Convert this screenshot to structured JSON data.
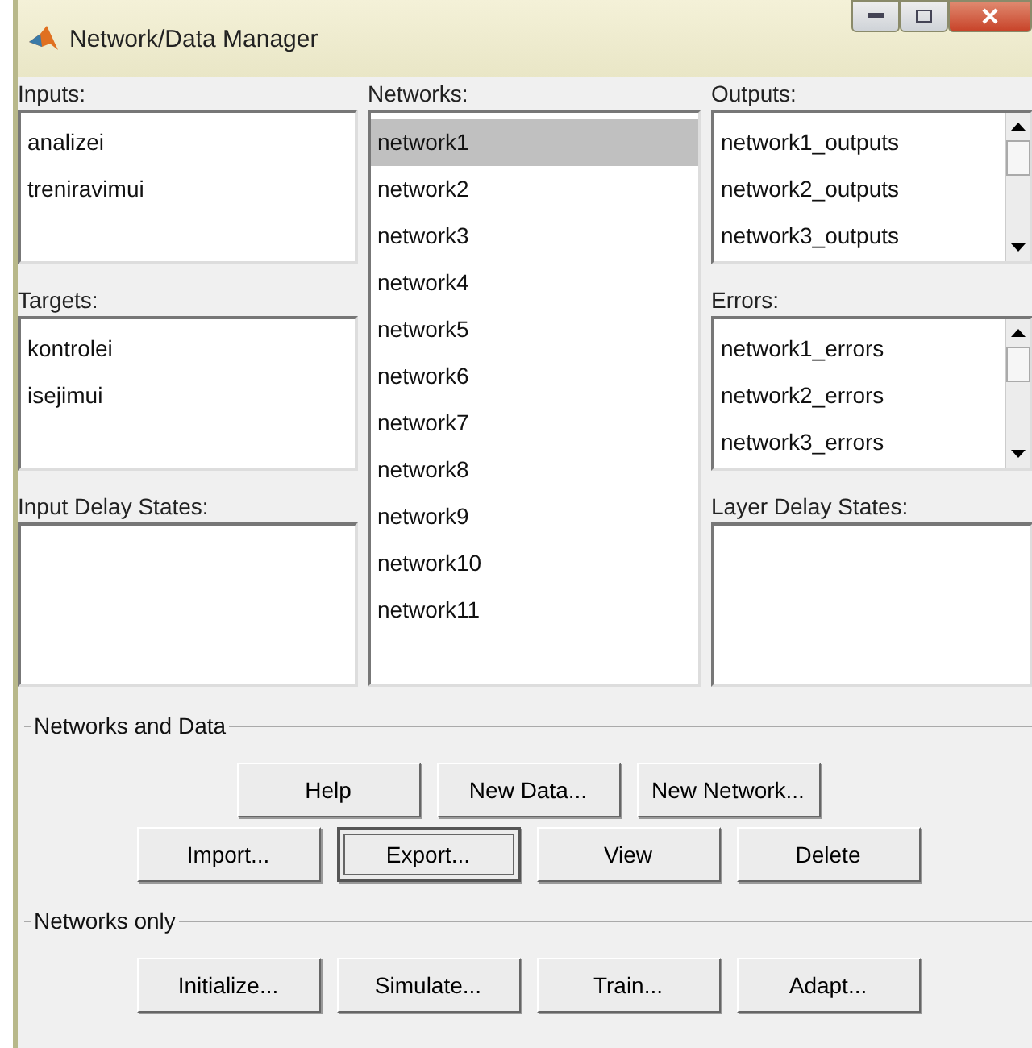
{
  "window": {
    "title": "Network/Data Manager"
  },
  "inputs": {
    "label": "Inputs:",
    "items": [
      "analizei",
      "treniravimui"
    ]
  },
  "targets": {
    "label": "Targets:",
    "items": [
      "kontrolei",
      "isejimui"
    ]
  },
  "input_delay_states": {
    "label": "Input Delay States:"
  },
  "networks": {
    "label": "Networks:",
    "items": [
      {
        "label": "network1",
        "selected": true
      },
      {
        "label": "network2",
        "selected": false
      },
      {
        "label": "network3",
        "selected": false
      },
      {
        "label": "network4",
        "selected": false
      },
      {
        "label": "network5",
        "selected": false
      },
      {
        "label": "network6",
        "selected": false
      },
      {
        "label": "network7",
        "selected": false
      },
      {
        "label": "network8",
        "selected": false
      },
      {
        "label": "network9",
        "selected": false
      },
      {
        "label": "network10",
        "selected": false
      },
      {
        "label": "network11",
        "selected": false
      }
    ]
  },
  "outputs": {
    "label": "Outputs:",
    "items": [
      "network1_outputs",
      "network2_outputs",
      "network3_outputs"
    ]
  },
  "errors": {
    "label": "Errors:",
    "items": [
      "network1_errors",
      "network2_errors",
      "network3_errors"
    ]
  },
  "layer_delay_states": {
    "label": "Layer Delay States:"
  },
  "groups": [
    {
      "title": "Networks and Data",
      "rows": [
        [
          {
            "label": "Help",
            "focused": false
          },
          {
            "label": "New Data...",
            "focused": false
          },
          {
            "label": "New Network...",
            "focused": false
          }
        ],
        [
          {
            "label": "Import...",
            "focused": false
          },
          {
            "label": "Export...",
            "focused": true
          },
          {
            "label": "View",
            "focused": false
          },
          {
            "label": "Delete",
            "focused": false
          }
        ]
      ]
    },
    {
      "title": "Networks only",
      "rows": [
        [
          {
            "label": "Initialize...",
            "focused": false
          },
          {
            "label": "Simulate...",
            "focused": false
          },
          {
            "label": "Train...",
            "focused": false
          },
          {
            "label": "Adapt...",
            "focused": false
          }
        ]
      ]
    }
  ]
}
